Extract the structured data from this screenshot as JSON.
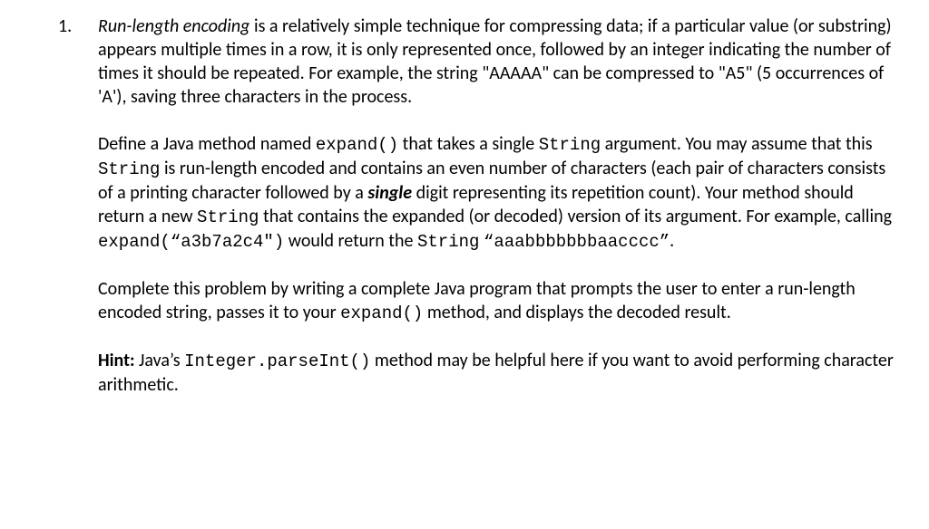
{
  "list_number": "1.",
  "p1": {
    "term": "Run-length encoding",
    "t1": " is a relatively simple technique for compressing data; if a particular value (or substring) appears multiple times in a row, it is only represented once, followed by an integer indicating the number of times it should be repeated. For example, the string \"AAAAA\" can be compressed to \"A5\" (5 occurrences of 'A'), saving three characters in the process."
  },
  "p2": {
    "t1": "Define a Java method named ",
    "m1": "expand()",
    "t2": " that takes a single ",
    "m2": "String",
    "t3": " argument. You may assume that this ",
    "m3": "String",
    "t4": " is run-length encoded and contains an even number of characters (each pair of characters consists of a printing character followed by a ",
    "bi": "single",
    "t5": " digit representing its repetition count). Your method should return a new ",
    "m4": "String",
    "t6": " that contains the expanded (or decoded) version of its argument. For example, calling ",
    "m5": "expand(“a3b7a2c4\")",
    "t7": " would return the ",
    "m6": "String",
    "t8": " ",
    "m7": "“aaabbbbbbbaacccc”",
    "t9": "."
  },
  "p3": {
    "t1": "Complete this problem by writing a complete Java program that prompts the user to enter a run-length encoded string, passes it to your ",
    "m1": "expand()",
    "t2": " method, and displays the decoded result."
  },
  "p4": {
    "b1": "Hint:",
    "t1": " Java’s ",
    "m1": "Integer.parseInt()",
    "t2": " method may be helpful here if you want to avoid performing character arithmetic."
  }
}
